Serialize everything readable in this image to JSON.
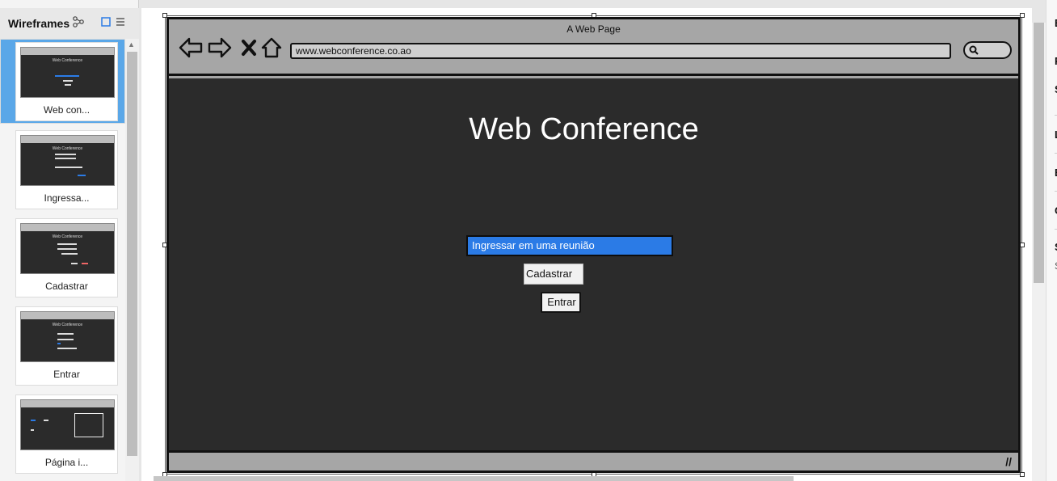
{
  "panel": {
    "title": "Wireframes"
  },
  "thumbnails": [
    {
      "label": "Web con...",
      "mini_title": "Web Conference"
    },
    {
      "label": "Ingressa...",
      "mini_title": "Web Conference"
    },
    {
      "label": "Cadastrar",
      "mini_title": "Web Conference"
    },
    {
      "label": "Entrar",
      "mini_title": "Web Conference"
    },
    {
      "label": "Página i...",
      "mini_title": ""
    }
  ],
  "browser": {
    "page_title": "A Web Page",
    "url": "www.webconference.co.ao"
  },
  "page": {
    "heading": "Web Conference",
    "join_input": "Ingressar em uma reunião",
    "cadastrar_button": "Cadastrar",
    "entrar_button": "Entrar"
  },
  "right_panel": {
    "letters": [
      "B",
      "P",
      "S",
      "L",
      "B",
      "C",
      "S"
    ],
    "bottom_letter": "S"
  },
  "colors": {
    "dark_background": "#2b2b2b",
    "browser_chrome": "#a6a6a6",
    "accent_blue": "#2b7be6",
    "selected_thumb": "#5aa7e8"
  }
}
